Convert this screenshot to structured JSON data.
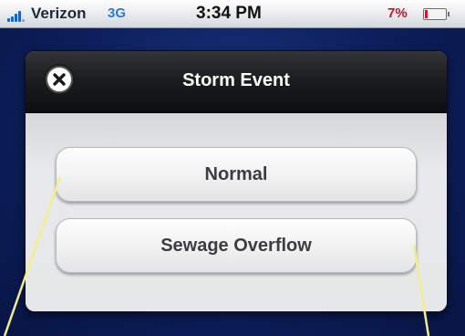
{
  "status_bar": {
    "carrier": "Verizon",
    "network": "3G",
    "time": "3:34 PM",
    "battery_percent": "7%",
    "battery_level": 0.07
  },
  "dialog": {
    "title": "Storm Event",
    "close_icon": "close-icon",
    "options": [
      "Normal",
      "Sewage Overflow"
    ]
  },
  "colors": {
    "callout_line": "#f2ee8c",
    "battery_low": "#d01a2c",
    "network_badge": "#2a7bd6"
  }
}
